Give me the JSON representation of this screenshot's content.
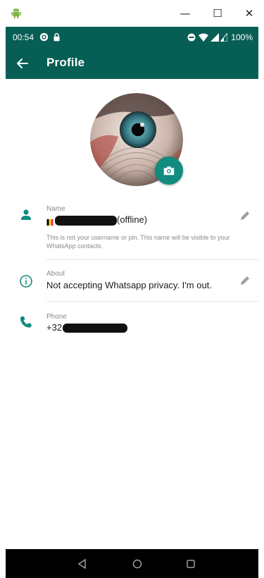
{
  "window": {
    "minimize": "—",
    "maximize": "☐",
    "close": "✕"
  },
  "status_bar": {
    "time": "00:54",
    "battery": "100%"
  },
  "header": {
    "title": "Profile"
  },
  "profile": {
    "name_field": {
      "label": "Name",
      "value_suffix": "(offline)",
      "hint": "This is not your username or pin. This name will be visible to your WhatsApp contacts."
    },
    "about_field": {
      "label": "About",
      "value": "Not accepting Whatsapp privacy. I'm out."
    },
    "phone_field": {
      "label": "Phone",
      "value_prefix": "+32"
    }
  },
  "colors": {
    "primary_dark": "#075e54",
    "accent": "#128c7e",
    "field_icon": "#128c7e"
  },
  "icons": {
    "window": "android-icon",
    "back": "arrow-left-icon",
    "camera": "camera-icon",
    "name": "person-icon",
    "about": "info-icon",
    "phone": "phone-icon",
    "edit": "pencil-icon",
    "nav": [
      "back-triangle-icon",
      "home-circle-icon",
      "recents-square-icon"
    ]
  }
}
